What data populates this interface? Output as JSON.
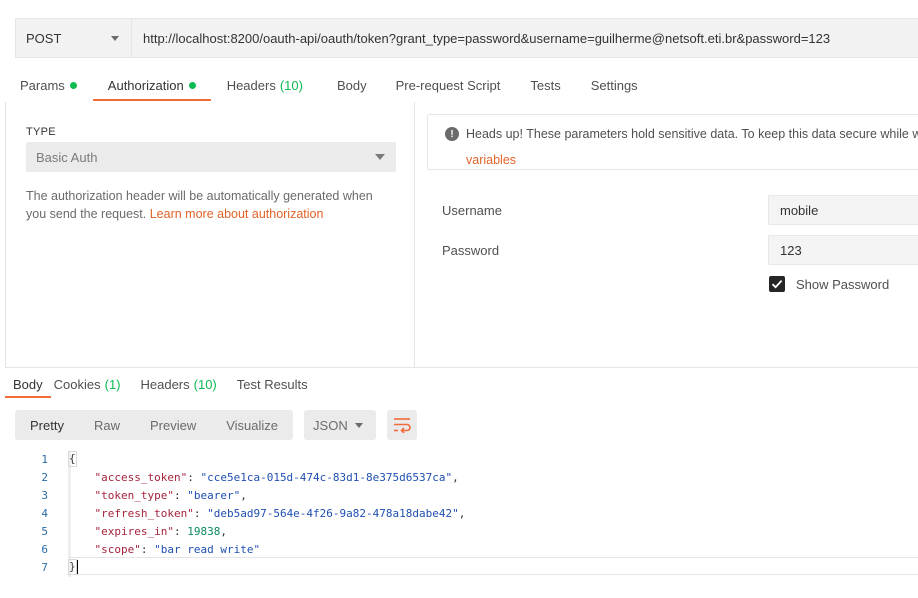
{
  "request": {
    "method": "POST",
    "url": "http://localhost:8200/oauth-api/oauth/token?grant_type=password&username=guilherme@netsoft.eti.br&password=123"
  },
  "request_tabs": {
    "params": "Params",
    "authorization": "Authorization",
    "headers": "Headers",
    "headers_count": "(10)",
    "body": "Body",
    "prerequest": "Pre-request Script",
    "tests": "Tests",
    "settings": "Settings"
  },
  "auth": {
    "type_label": "TYPE",
    "type_value": "Basic Auth",
    "description": "The authorization header will be automatically generated when you send the request.",
    "learn_more": "Learn more about authorization",
    "warning_text": "Heads up! These parameters hold sensitive data. To keep this data secure while w",
    "warning_link": "variables",
    "username_label": "Username",
    "username_value": "mobile",
    "password_label": "Password",
    "password_value": "123",
    "show_password_label": "Show Password",
    "show_password_checked": true
  },
  "response_tabs": {
    "body": "Body",
    "cookies": "Cookies",
    "cookies_count": "(1)",
    "headers": "Headers",
    "headers_count": "(10)",
    "test_results": "Test Results"
  },
  "response_toolbar": {
    "pretty": "Pretty",
    "raw": "Raw",
    "preview": "Preview",
    "visualize": "Visualize",
    "format": "JSON"
  },
  "response_body": {
    "line_numbers": [
      "1",
      "2",
      "3",
      "4",
      "5",
      "6",
      "7"
    ],
    "open_brace": "{",
    "close_brace": "}",
    "access_token_key": "\"access_token\"",
    "access_token_value": "\"cce5e1ca-015d-474c-83d1-8e375d6537ca\"",
    "token_type_key": "\"token_type\"",
    "token_type_value": "\"bearer\"",
    "refresh_token_key": "\"refresh_token\"",
    "refresh_token_value": "\"deb5ad97-564e-4f26-9a82-478a18dabe42\"",
    "expires_in_key": "\"expires_in\"",
    "expires_in_value": "19838",
    "scope_key": "\"scope\"",
    "scope_value": "\"bar read write\""
  },
  "colors": {
    "accent": "#f26b3a",
    "status_green": "#0cbb52"
  }
}
